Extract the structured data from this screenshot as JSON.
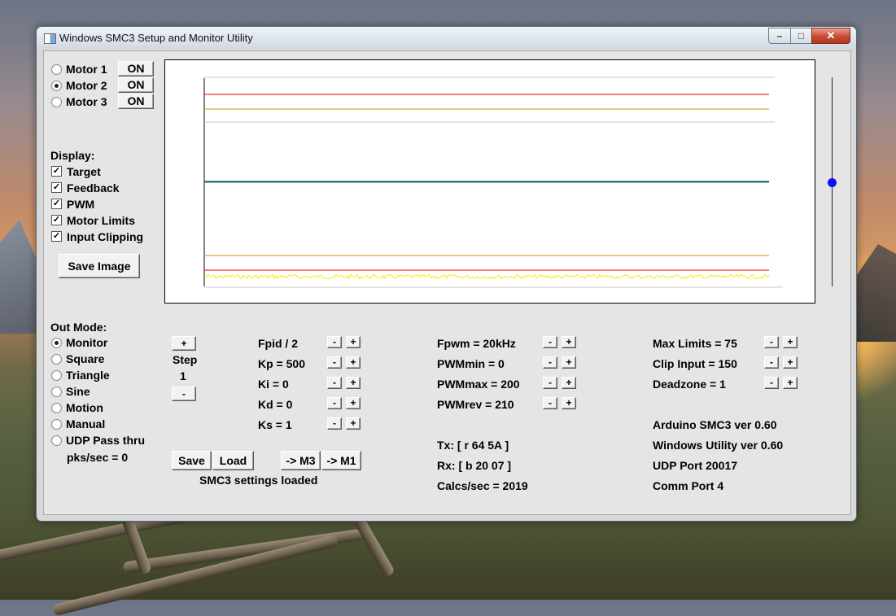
{
  "window": {
    "title": "Windows SMC3 Setup and Monitor Utility",
    "controls": {
      "minimize": "–",
      "maximize": "□",
      "close": "✕"
    }
  },
  "motors": [
    {
      "label": "Motor 1",
      "selected": false,
      "button": "ON"
    },
    {
      "label": "Motor 2",
      "selected": true,
      "button": "ON"
    },
    {
      "label": "Motor 3",
      "selected": false,
      "button": "ON"
    }
  ],
  "display": {
    "heading": "Display:",
    "items": [
      {
        "label": "Target",
        "checked": true
      },
      {
        "label": "Feedback",
        "checked": true
      },
      {
        "label": "PWM",
        "checked": true
      },
      {
        "label": "Motor Limits",
        "checked": true
      },
      {
        "label": "Input Clipping",
        "checked": true
      }
    ],
    "save_image": "Save Image"
  },
  "out_mode": {
    "heading": "Out Mode:",
    "options": [
      {
        "label": "Monitor",
        "selected": true
      },
      {
        "label": "Square",
        "selected": false
      },
      {
        "label": "Triangle",
        "selected": false
      },
      {
        "label": "Sine",
        "selected": false
      },
      {
        "label": "Motion",
        "selected": false
      },
      {
        "label": "Manual",
        "selected": false
      },
      {
        "label": "UDP Pass thru",
        "selected": false
      }
    ],
    "pks": "pks/sec = 0"
  },
  "step": {
    "plus": "+",
    "label": "Step",
    "value": "1",
    "minus": "-"
  },
  "pid": [
    "Fpid / 2",
    "Kp = 500",
    "Ki = 0",
    "Kd = 0",
    "Ks = 1"
  ],
  "pwm": [
    "Fpwm = 20kHz",
    "PWMmin = 0",
    "PWMmax = 200",
    "PWMrev = 210"
  ],
  "limits": [
    "Max Limits = 75",
    "Clip Input = 150",
    "Deadzone = 1"
  ],
  "adjust": {
    "minus": "-",
    "plus": "+"
  },
  "comm": {
    "tx": "Tx: [ r 64 5A ]",
    "rx": "Rx: [ b 20 07 ]",
    "calcs": "Calcs/sec = 2019"
  },
  "versions": {
    "arduino": "Arduino SMC3 ver 0.60",
    "utility": "Windows Utility ver 0.60",
    "udp": "UDP Port 20017",
    "comm_port": "Comm Port 4"
  },
  "actions": {
    "save": "Save",
    "load": "Load",
    "to_m3": "-> M3",
    "to_m1": "-> M1",
    "status": "SMC3 settings loaded"
  },
  "graph": {
    "colors": {
      "limits": "#ee3322",
      "clipping": "#e8a030",
      "target": "#1a5a8a",
      "feedback": "#1a7a4a",
      "pwm": "#f2ee00",
      "frame": "#c8c8c8"
    }
  },
  "slider": {
    "value": 0.5
  }
}
